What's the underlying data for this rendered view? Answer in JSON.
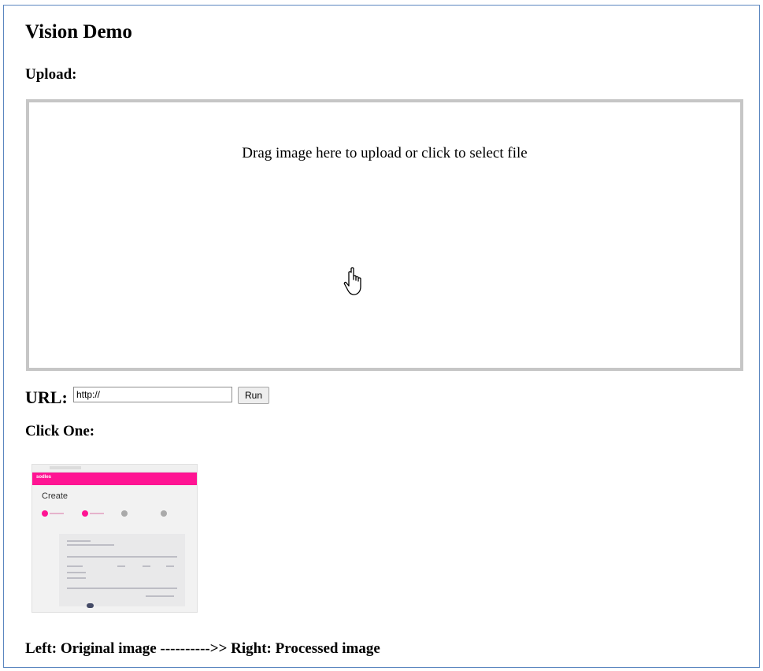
{
  "page": {
    "title": "Vision Demo",
    "upload_label": "Upload:",
    "dropzone_text": "Drag image here to upload or click to select file"
  },
  "url": {
    "label": "URL:",
    "value": "http://",
    "run_label": "Run"
  },
  "examples": {
    "label": "Click One:",
    "items": [
      {
        "icon": "sample-screenshot-thumbnail",
        "brand": "sodles",
        "heading": "Create",
        "accent_color": "#ff1493"
      }
    ]
  },
  "caption": "Left: Original image ---------->> Right: Processed image",
  "colors": {
    "frame_border": "#5b86c0",
    "dropzone_border": "#c6c6c6"
  }
}
